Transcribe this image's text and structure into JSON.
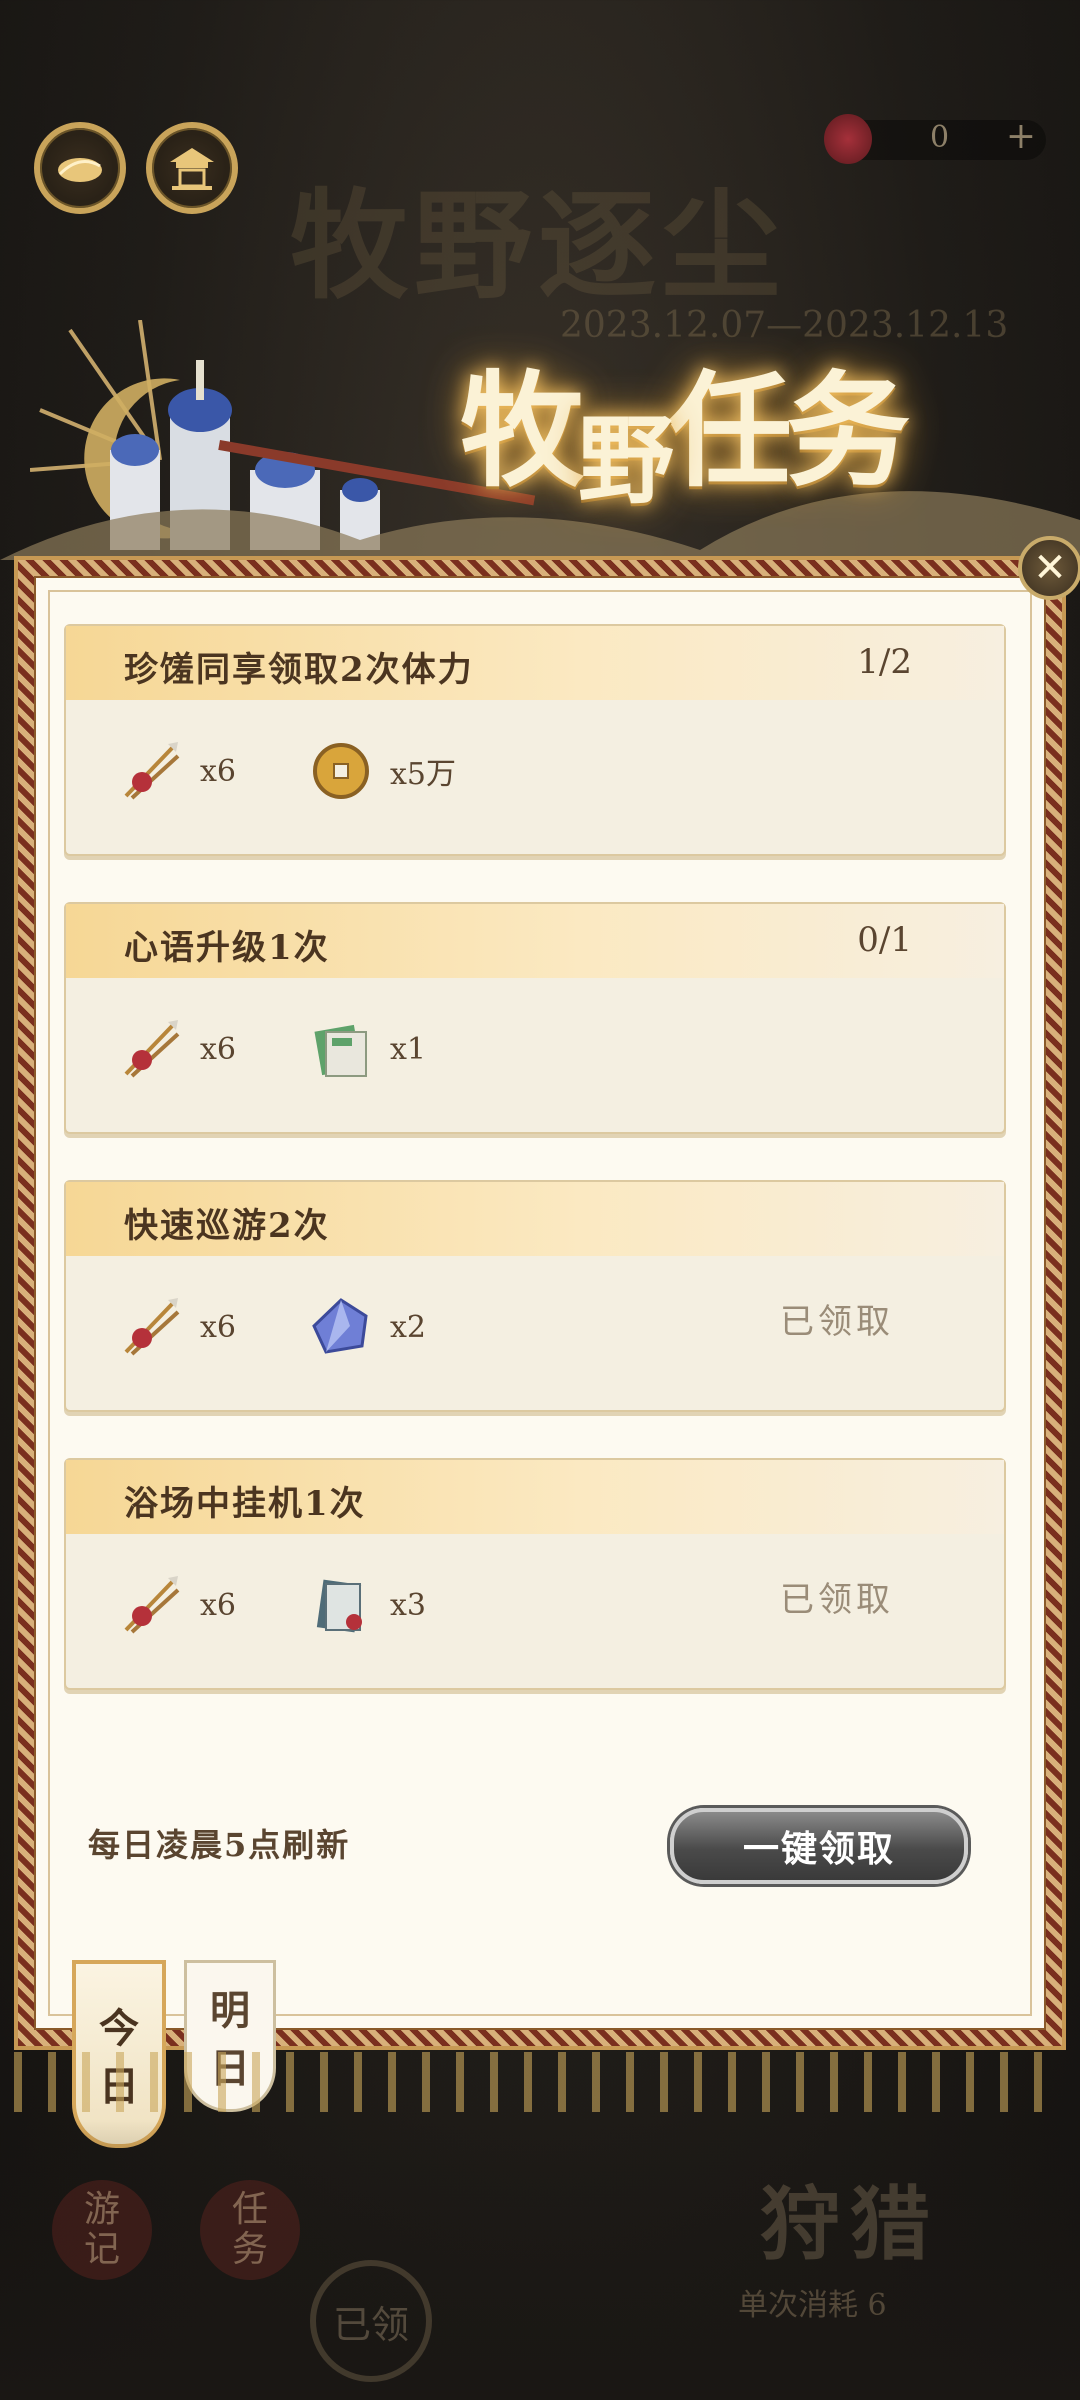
{
  "background": {
    "title": "牧野逐尘",
    "date_range": "2023.12.07—2023.12.13",
    "currency_count": "0",
    "plus_symbol": "+"
  },
  "headline": {
    "part1": "牧",
    "part2": "野",
    "part3": "任务"
  },
  "close_symbol": "✕",
  "tasks": [
    {
      "title": "珍馐同享领取2次体力",
      "progress": "1/2",
      "rewards": [
        {
          "icon": "arrows-icon",
          "qty": "x6"
        },
        {
          "icon": "coin-icon",
          "qty": "x5万"
        }
      ],
      "status": ""
    },
    {
      "title": "心语升级1次",
      "progress": "0/1",
      "rewards": [
        {
          "icon": "arrows-icon",
          "qty": "x6"
        },
        {
          "icon": "green-book-icon",
          "qty": "x1"
        }
      ],
      "status": ""
    },
    {
      "title": "快速巡游2次",
      "progress": "",
      "rewards": [
        {
          "icon": "arrows-icon",
          "qty": "x6"
        },
        {
          "icon": "blue-crystal-icon",
          "qty": "x2"
        }
      ],
      "status": "已领取"
    },
    {
      "title": "浴场中挂机1次",
      "progress": "",
      "rewards": [
        {
          "icon": "arrows-icon",
          "qty": "x6"
        },
        {
          "icon": "scroll-book-icon",
          "qty": "x3"
        }
      ],
      "status": "已领取"
    }
  ],
  "footer": {
    "refresh_note": "每日凌晨5点刷新",
    "claim_all_label": "一键领取"
  },
  "tabs": {
    "today_1": "今",
    "today_2": "日",
    "tomorrow_1": "明",
    "tomorrow_2": "日"
  },
  "bottom_bg": {
    "left_1_a": "游",
    "left_1_b": "记",
    "left_2_a": "任",
    "left_2_b": "务",
    "seal": "已领",
    "hunt": "狩猎",
    "hunt_sub": "单次消耗",
    "hunt_cost": "6"
  },
  "colors": {
    "gold": "#c9a45a",
    "panel": "#fdfaf1",
    "card": "#f4efe1",
    "text_dark": "#4b3520",
    "claimed_text": "#9a8c78"
  }
}
